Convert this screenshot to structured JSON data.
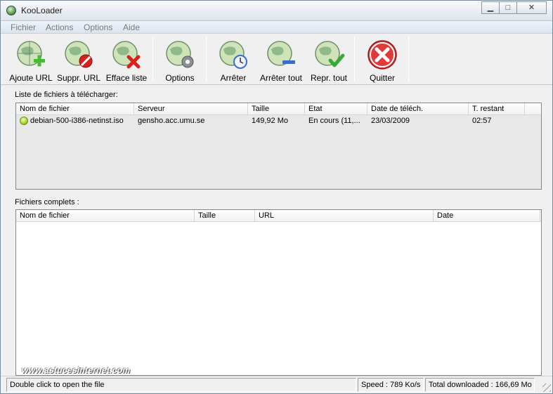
{
  "window": {
    "title": "KooLoader"
  },
  "menu": {
    "items": [
      "Fichier",
      "Actions",
      "Options",
      "Aide"
    ]
  },
  "toolbar": {
    "buttons": [
      {
        "label": "Ajoute URL",
        "icon": "globe-plus-icon"
      },
      {
        "label": "Suppr. URL",
        "icon": "globe-remove-icon"
      },
      {
        "label": "Efface liste",
        "icon": "globe-clear-icon"
      },
      {
        "label": "Options",
        "icon": "globe-gear-icon"
      },
      {
        "label": "Arrêter",
        "icon": "globe-clock-icon"
      },
      {
        "label": "Arrêter tout",
        "icon": "globe-stop-all-icon"
      },
      {
        "label": "Repr. tout",
        "icon": "globe-check-icon"
      },
      {
        "label": "Quitter",
        "icon": "quit-x-icon"
      }
    ]
  },
  "downloads": {
    "label": "Liste de fichiers à télécharger:",
    "columns": [
      "Nom de fichier",
      "Serveur",
      "Taille",
      "Etat",
      "Date de téléch.",
      "T. restant"
    ],
    "rows": [
      {
        "filename": "debian-500-i386-netinst.iso",
        "server": "gensho.acc.umu.se",
        "size": "149,92 Mo",
        "state": "En cours (11,...",
        "date": "23/03/2009",
        "remaining": "02:57"
      }
    ]
  },
  "completed": {
    "label": "Fichiers complets :",
    "columns": [
      "Nom de fichier",
      "Taille",
      "URL",
      "Date"
    ],
    "rows": []
  },
  "watermark": "www.astucesinternet.com",
  "statusbar": {
    "hint": "Double click to open the file",
    "speed": "Speed : 789 Ko/s",
    "total": "Total downloaded : 166,69 Mo"
  },
  "colors": {
    "accent_green": "#a9d22a",
    "quit_red": "#d82020",
    "window_bg": "#f0f0f0"
  }
}
